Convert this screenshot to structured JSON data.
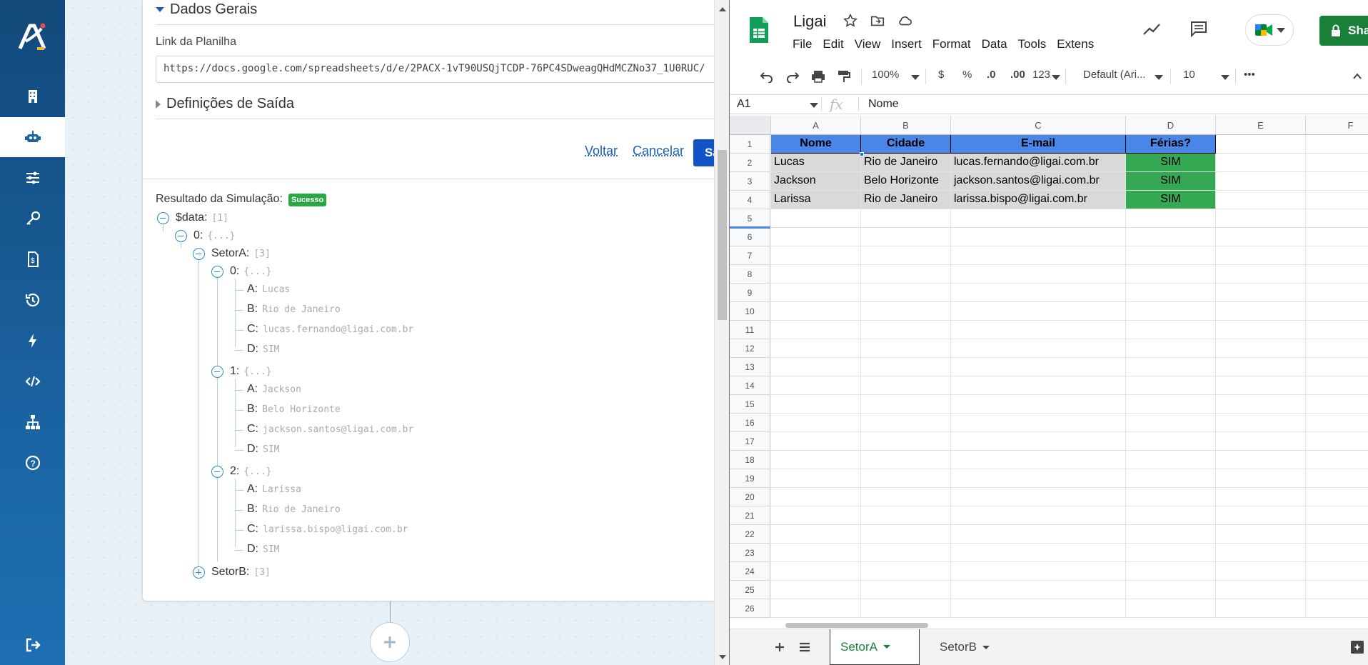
{
  "nav": {
    "items": [
      "building-icon",
      "robot-icon",
      "sliders-icon",
      "key-icon",
      "document-dollar-icon",
      "history-icon",
      "bolt-icon",
      "code-icon",
      "network-icon",
      "help-icon"
    ],
    "logout": "logout-icon"
  },
  "form": {
    "dados_gerais": "Dados Gerais",
    "link_label": "Link da Planilha",
    "link_value": "https://docs.google.com/spreadsheets/d/e/2PACX-1vT90USQjTCDP-76PC4SDweagQHdMCZNo37_1U0RUC/",
    "definicoes": "Definições de Saída",
    "voltar": "Voltar",
    "cancelar": "Cancelar",
    "salvar": "Salvar"
  },
  "simulation": {
    "label": "Resultado da Simulação:",
    "badge": "Sucesso",
    "root_key": "$data:",
    "root_val": "[1]",
    "item0_key": "0:",
    "obj_val": "{...}",
    "setorA_key": "SetorA:",
    "setorA_val": "[3]",
    "setorB_key": "SetorB:",
    "setorB_val": "[3]",
    "records": [
      {
        "key": "0:",
        "A": "Lucas",
        "B": "Rio de Janeiro",
        "C": "lucas.fernando@ligai.com.br",
        "D": "SIM"
      },
      {
        "key": "1:",
        "A": "Jackson",
        "B": "Belo Horizonte",
        "C": "jackson.santos@ligai.com.br",
        "D": "SIM"
      },
      {
        "key": "2:",
        "A": "Larissa",
        "B": "Rio de Janeiro",
        "C": "larissa.bispo@ligai.com.br",
        "D": "SIM"
      }
    ],
    "field_labels": {
      "A": "A:",
      "B": "B:",
      "C": "C:",
      "D": "D:"
    }
  },
  "sheets": {
    "title": "Ligai",
    "menu": [
      "File",
      "Edit",
      "View",
      "Insert",
      "Format",
      "Data",
      "Tools",
      "Extens"
    ],
    "share": "Share",
    "zoom": "100%",
    "currency": "$",
    "percent": "%",
    "dec_dec": ".0",
    "dec_inc": ".00",
    "format_123": "123",
    "font": "Default (Ari...",
    "font_size": "10",
    "more": "•••",
    "namebox": "A1",
    "fx": "fx",
    "formula": "Nome",
    "columns": [
      "A",
      "B",
      "C",
      "D",
      "E",
      "F"
    ],
    "rows": [
      "1",
      "2",
      "3",
      "4",
      "5",
      "6",
      "7",
      "8",
      "9",
      "10",
      "11",
      "12",
      "13",
      "14",
      "15",
      "16",
      "17",
      "18",
      "19",
      "20",
      "21",
      "22",
      "23",
      "24",
      "25",
      "26"
    ],
    "header": [
      "Nome",
      "Cidade",
      "E-mail",
      "Férias?"
    ],
    "data": [
      [
        "Lucas",
        "Rio de Janeiro",
        "lucas.fernando@ligai.com.br",
        "SIM"
      ],
      [
        "Jackson",
        "Belo Horizonte",
        "jackson.santos@ligai.com.br",
        "SIM"
      ],
      [
        "Larissa",
        "Rio de Janeiro",
        "larissa.bispo@ligai.com.br",
        "SIM"
      ]
    ],
    "tabs": [
      "SetorA",
      "SetorB"
    ],
    "active_tab": "SetorA"
  }
}
